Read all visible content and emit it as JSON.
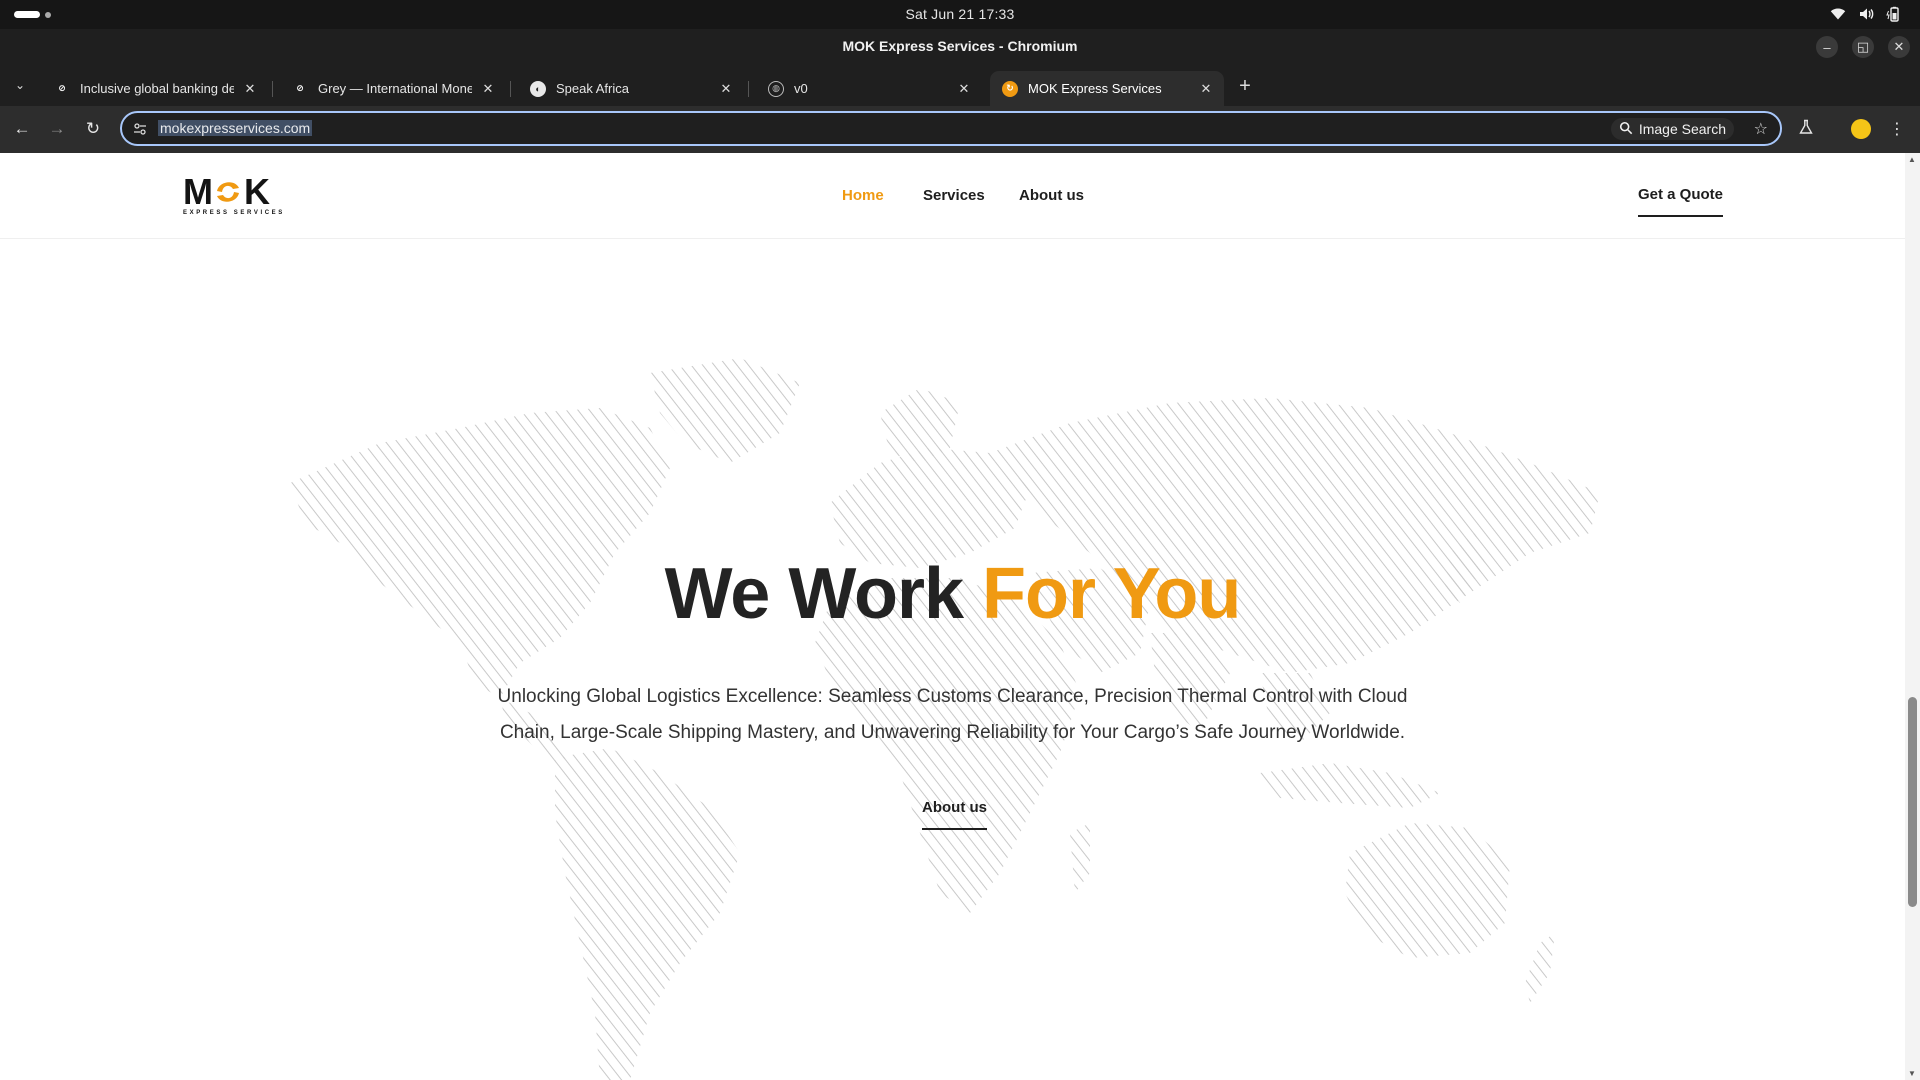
{
  "os": {
    "clock": "Sat Jun 21  17:33",
    "tray_icons": [
      "wifi-icon",
      "volume-icon",
      "battery-icon"
    ]
  },
  "window": {
    "title": "MOK Express Services - Chromium",
    "controls": [
      "minimize-icon",
      "maximize-icon",
      "close-icon"
    ]
  },
  "tabs": [
    {
      "label": "Inclusive global banking desi",
      "icon": "grey-favicon",
      "active": false
    },
    {
      "label": "Grey — International Money",
      "icon": "grey-favicon",
      "active": false
    },
    {
      "label": "Speak Africa",
      "icon": "globe-favicon",
      "active": false
    },
    {
      "label": "v0",
      "icon": "globe-favicon",
      "active": false
    },
    {
      "label": "MOK Express Services",
      "icon": "mok-favicon",
      "active": true
    }
  ],
  "toolbar": {
    "url": "mokexpresservices.com",
    "image_search": "Image Search"
  },
  "site": {
    "logo_text": "MOK",
    "logo_sub": "EXPRESS SERVICES",
    "nav": [
      {
        "label": "Home",
        "active": true
      },
      {
        "label": "Services",
        "active": false
      },
      {
        "label": "About us",
        "active": false
      }
    ],
    "cta": "Get a Quote",
    "accent_color": "#f09a12"
  },
  "hero": {
    "title_main": "We Work ",
    "title_accent": "For You",
    "description": "Unlocking Global Logistics Excellence: Seamless Customs Clearance, Precision Thermal Control with Cloud Chain, Large-Scale Shipping Mastery, and Unwavering Reliability for Your Cargo’s Safe Journey Worldwide.",
    "button": "About us"
  }
}
